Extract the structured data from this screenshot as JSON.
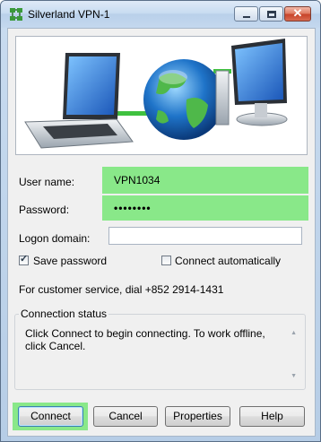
{
  "window": {
    "title": "Silverland VPN-1"
  },
  "title_buttons": {
    "close_glyph": "✕"
  },
  "form": {
    "username_label": "User name:",
    "username_value": "VPN1034",
    "password_label": "Password:",
    "password_value": "••••••••",
    "domain_label": "Logon domain:",
    "domain_value": ""
  },
  "options": {
    "save_password_label": "Save password",
    "save_password_checked": true,
    "connect_auto_label": "Connect automatically",
    "connect_auto_checked": false
  },
  "support_text": "For customer service, dial +852 2914-1431",
  "status": {
    "title": "Connection status",
    "message": "Click Connect to begin connecting.  To work offline, click Cancel."
  },
  "buttons": {
    "connect": "Connect",
    "cancel": "Cancel",
    "properties": "Properties",
    "help": "Help"
  },
  "colors": {
    "highlight": "#89e889",
    "window_frame": "#b6cde6"
  }
}
